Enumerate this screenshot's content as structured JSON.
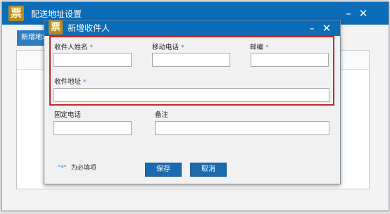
{
  "outer_window": {
    "logo_char": "票",
    "title": "配送地址设置",
    "toolbar_button": "新增地址",
    "minimize": "–",
    "close": "✕"
  },
  "dialog": {
    "logo_char": "票",
    "title": "新增收件人",
    "minimize": "–",
    "close": "✕",
    "required_mark": "*",
    "fields": {
      "recipient_name": {
        "label": "收件人姓名",
        "value": "",
        "required": true
      },
      "mobile": {
        "label": "移动电话",
        "value": "",
        "required": true
      },
      "postcode": {
        "label": "邮编",
        "value": "",
        "required": true
      },
      "address": {
        "label": "收件地址",
        "value": "",
        "required": true
      },
      "landline": {
        "label": "固定电话",
        "value": "",
        "required": false
      },
      "remark": {
        "label": "备注",
        "value": "",
        "required": false
      }
    },
    "required_note_mark": "\"*\"",
    "required_note": "为必填项",
    "save_label": "保存",
    "cancel_label": "取消"
  },
  "colors": {
    "title_bar": "#0b6cb8",
    "highlight_border": "#c62828",
    "button": "#1b6ab0",
    "required_mark": "#2f7fd0"
  }
}
